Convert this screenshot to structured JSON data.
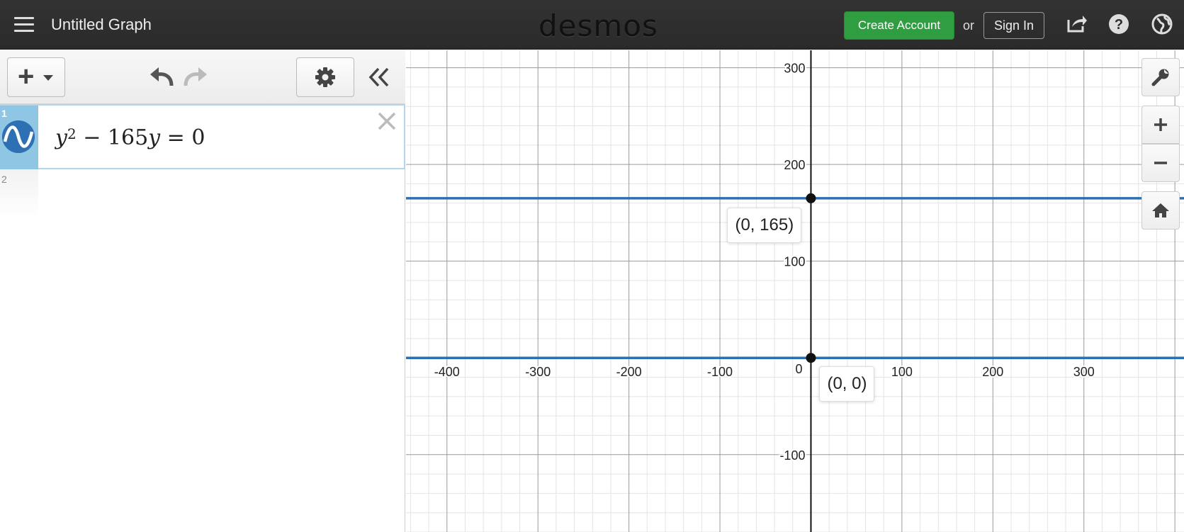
{
  "header": {
    "title": "Untitled Graph",
    "logo": "desmos",
    "create_account": "Create Account",
    "or": "or",
    "sign_in": "Sign In",
    "icons": [
      "share-icon",
      "help-icon",
      "language-globe-icon"
    ]
  },
  "toolbar": {
    "add_label": "+",
    "icons": [
      "add-icon",
      "undo-icon",
      "redo-icon",
      "gear-icon",
      "collapse-icon"
    ]
  },
  "expressions": [
    {
      "index": "1",
      "base": "y",
      "exp": "2",
      "rest_op": " − 165",
      "rest_var": "y",
      "tail": " = 0"
    },
    {
      "index": "2"
    }
  ],
  "graph": {
    "x_ticks": [
      "-400",
      "-300",
      "-200",
      "-100",
      "100",
      "200",
      "300"
    ],
    "y_ticks": [
      "300",
      "200",
      "100",
      "-100"
    ],
    "origin": "0",
    "line_color": "#2d70b3",
    "line_y_values": [
      165,
      0
    ],
    "points": [
      {
        "label": "(0, 165)",
        "x": 0,
        "y": 165
      },
      {
        "label": "(0, 0)",
        "x": 0,
        "y": 0
      }
    ],
    "x_range": [
      -445,
      410
    ],
    "y_range": [
      -180,
      318
    ]
  },
  "controls": [
    "wrench-icon",
    "zoom-in-icon",
    "zoom-out-icon",
    "home-icon"
  ],
  "colors": {
    "header": "#2d2d2d",
    "create_account": "#2f9e41",
    "expression_tab": "#8fc6e3",
    "curve": "#2d70b3"
  }
}
